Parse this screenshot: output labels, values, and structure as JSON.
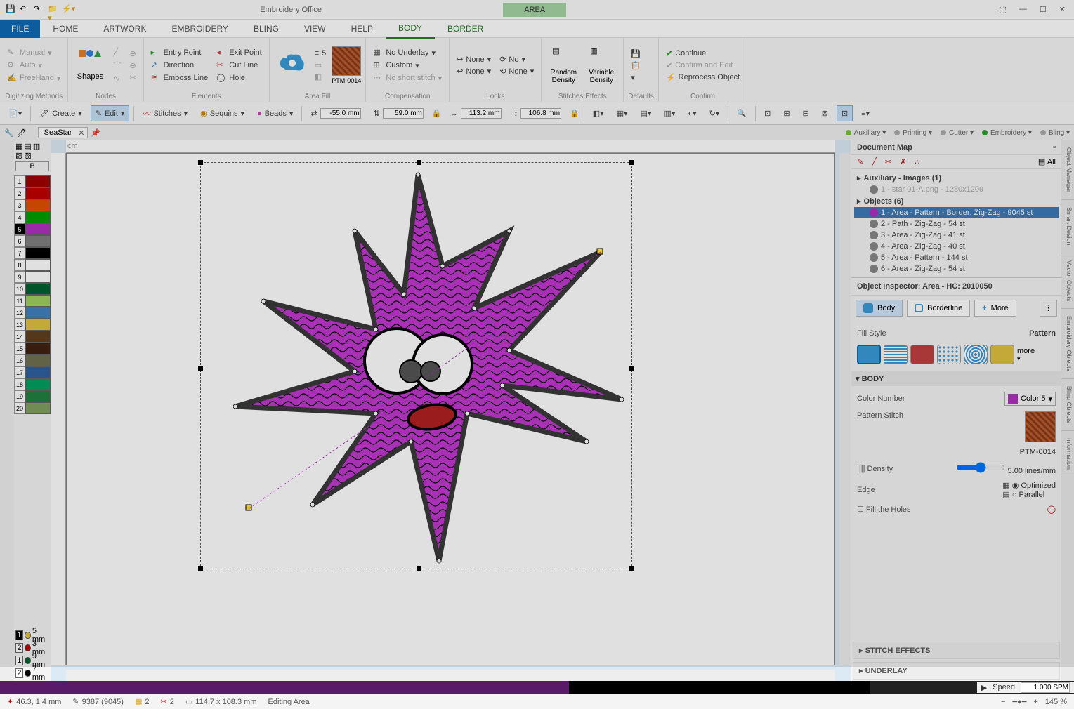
{
  "app": {
    "title": "Embroidery Office",
    "context_tab": "AREA"
  },
  "ribbon_tabs": [
    "FILE",
    "HOME",
    "ARTWORK",
    "EMBROIDERY",
    "BLING",
    "VIEW",
    "HELP",
    "BODY",
    "BORDER"
  ],
  "ribbon": {
    "digitizing": {
      "label": "Digitizing Methods",
      "manual": "Manual",
      "auto": "Auto",
      "freehand": "FreeHand"
    },
    "shapes": {
      "label": "Nodes",
      "shapes_label": "Shapes"
    },
    "elements": {
      "label": "Elements",
      "entry": "Entry Point",
      "exit": "Exit Point",
      "direction": "Direction",
      "cut": "Cut Line",
      "emboss": "Emboss Line",
      "hole": "Hole"
    },
    "areafill": {
      "label": "Area Fill",
      "code": "PTM-0014",
      "val1": "5"
    },
    "compensation": {
      "label": "Compensation",
      "underlay": "No Underlay",
      "custom": "Custom",
      "noshort": "No short stitch"
    },
    "locks": {
      "label": "Locks",
      "none1": "None",
      "none2": "No",
      "none3": "None",
      "none4": "None"
    },
    "stitches_effects": {
      "label": "Stitches Effects",
      "random": "Random Density",
      "variable": "Variable Density"
    },
    "defaults": {
      "label": "Defaults"
    },
    "confirm": {
      "label": "Confirm",
      "continue": "Continue",
      "confirm_edit": "Confirm and Edit",
      "reprocess": "Reprocess Object"
    }
  },
  "toolbar2": {
    "create": "Create",
    "edit": "Edit",
    "stitches": "Stitches",
    "sequins": "Sequins",
    "beads": "Beads",
    "x": "-55.0 mm",
    "y": "59.0 mm",
    "w": "113.2 mm",
    "h": "106.8 mm"
  },
  "worktabs": {
    "doc": "SeaStar",
    "tags": [
      {
        "name": "Auxiliary",
        "color": "#7cbf3a"
      },
      {
        "name": "Printing",
        "color": "#aaa"
      },
      {
        "name": "Cutter",
        "color": "#aaa"
      },
      {
        "name": "Embroidery",
        "color": "#2a9c2a"
      },
      {
        "name": "Bling",
        "color": "#aaa"
      }
    ]
  },
  "palette": {
    "colors": [
      "#a00000",
      "#c00000",
      "#e05000",
      "#00a000",
      "#b030c0",
      "#808080",
      "#000000",
      "",
      "",
      "#006030",
      "#a0d060",
      "#4080c0",
      "#e0c040",
      "#604020",
      "#402010",
      "#707050",
      "#3060a0",
      "#00a060",
      "#208040",
      "#80a060"
    ],
    "needles": [
      {
        "n": "1",
        "size": "5 mm",
        "color": "#e0c040",
        "sel": true
      },
      {
        "n": "2",
        "size": "3 mm",
        "color": "#c00000"
      },
      {
        "n": "1",
        "size": "9 mm",
        "color": "#006030"
      },
      {
        "n": "2",
        "size": "7 mm",
        "color": "#000000"
      }
    ]
  },
  "ruler_unit": "cm",
  "doc_map": {
    "title": "Document Map",
    "all": "All",
    "nodes": [
      {
        "label": "Auxiliary - Images (1)",
        "bold": true
      },
      {
        "label": "1 - star 01-A.png - 1280x1209",
        "indent": true,
        "dim": true
      },
      {
        "label": "Objects (6)",
        "bold": true
      },
      {
        "label": "1 - Area - Pattern - Border: Zig-Zag - 9045 st",
        "indent": true,
        "sel": true
      },
      {
        "label": "2 - Path - Zig-Zag - 54 st",
        "indent": true
      },
      {
        "label": "3 - Area - Zig-Zag - 41 st",
        "indent": true
      },
      {
        "label": "4 - Area - Zig-Zag - 40 st",
        "indent": true
      },
      {
        "label": "5 - Area - Pattern - 144 st",
        "indent": true
      },
      {
        "label": "6 - Area - Zig-Zag - 54 st",
        "indent": true
      }
    ]
  },
  "inspector": {
    "title": "Object Inspector: Area - HC: 2010050",
    "tabs": {
      "body": "Body",
      "borderline": "Borderline",
      "more": "More"
    },
    "fill_style": "Fill Style",
    "pattern": "Pattern",
    "more_sw": "more",
    "body_section": "BODY",
    "color_number_label": "Color Number",
    "color_value": "Color 5",
    "pattern_stitch_label": "Pattern Stitch",
    "pattern_code": "PTM-0014",
    "density_label": "Density",
    "density_value": "5.00 lines/mm",
    "edge_label": "Edge",
    "optimized": "Optimized",
    "parallel": "Parallel",
    "fill_holes": "Fill the Holes",
    "stitch_effects": "STITCH EFFECTS",
    "underlay": "UNDERLAY"
  },
  "side_tabs": [
    "Object Manager",
    "Smart Design",
    "Vector Objects",
    "Embroidery Objects",
    "Bling Objects",
    "Information"
  ],
  "timeline": {
    "speed_label": "Speed",
    "speed_value": "1.000 SPM"
  },
  "status": {
    "coords": "46.3, 1.4 mm",
    "stitches": "9387 (9045)",
    "colors": "2",
    "cuts": "2",
    "size": "114.7 x 108.3 mm",
    "mode": "Editing Area",
    "zoom": "145 %"
  }
}
